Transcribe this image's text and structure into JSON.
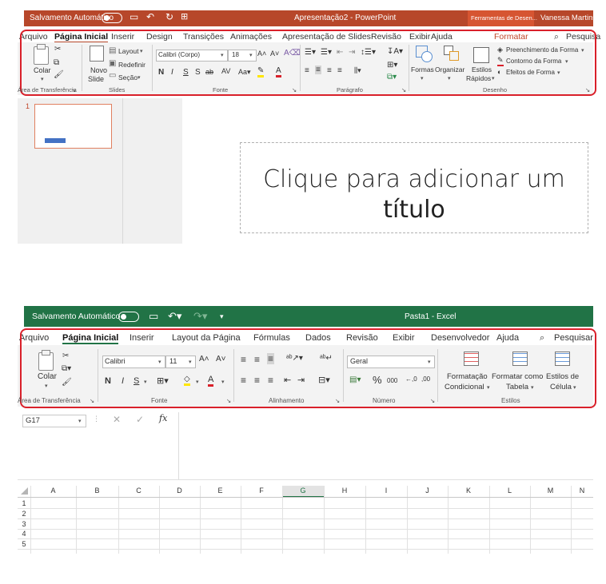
{
  "ppt": {
    "autosave": "Salvamento Automático",
    "file_title": "Apresentação2  -  PowerPoint",
    "context_tab": "Ferramentas de Desen...",
    "user": "Vanessa Martins",
    "tabs": [
      "Arquivo",
      "Página Inicial",
      "Inserir",
      "Design",
      "Transições",
      "Animações",
      "Apresentação de Slides",
      "Revisão",
      "Exibir",
      "Ajuda"
    ],
    "format_tab": "Formatar",
    "search": "Pesquisa",
    "colar": "Colar",
    "novo_slide_1": "Novo",
    "novo_slide_2": "Slide",
    "layout": "Layout",
    "redefinir": "Redefinir",
    "secao": "Seção",
    "font_name": "Calibri (Corpo)",
    "font_size": "18",
    "formas": "Formas",
    "organizar": "Organizar",
    "estilos_1": "Estilos",
    "estilos_2": "Rápidos",
    "preenchimento": "Preenchimento da Forma",
    "contorno": "Contorno da Forma",
    "efeitos": "Efeitos de Forma",
    "groups": {
      "transfer": "Área de Transferência",
      "slides": "Slides",
      "fonte": "Fonte",
      "paragrafo": "Parágrafo",
      "desenho": "Desenho"
    },
    "slide_number": "1",
    "title_placeholder_1": "Clique para adicionar um",
    "title_placeholder_2": "título"
  },
  "excel": {
    "autosave": "Salvamento Automático",
    "file_title": "Pasta1  -  Excel",
    "tabs": [
      "Arquivo",
      "Página Inicial",
      "Inserir",
      "Layout da Página",
      "Fórmulas",
      "Dados",
      "Revisão",
      "Exibir",
      "Desenvolvedor",
      "Ajuda"
    ],
    "search": "Pesquisar",
    "colar": "Colar",
    "font_name": "Calibri",
    "font_size": "11",
    "number_format": "Geral",
    "formatacao_1": "Formatação",
    "formatacao_2": "Condicional",
    "formatar_1": "Formatar como",
    "formatar_2": "Tabela",
    "estilos_1": "Estilos de",
    "estilos_2": "Célula",
    "groups": {
      "transfer": "Área de Transferência",
      "fonte": "Fonte",
      "alinhamento": "Alinhamento",
      "numero": "Número",
      "estilos": "Estilos"
    },
    "name_box": "G17",
    "fx": "fx",
    "columns": [
      "A",
      "B",
      "C",
      "D",
      "E",
      "F",
      "G",
      "H",
      "I",
      "J",
      "K",
      "L",
      "M",
      "N"
    ],
    "rows": [
      "1",
      "2",
      "3",
      "4",
      "5"
    ]
  },
  "colors": {
    "ppt_accent": "#b7472a",
    "excel_accent": "#217346",
    "highlight": "#d9202a"
  }
}
